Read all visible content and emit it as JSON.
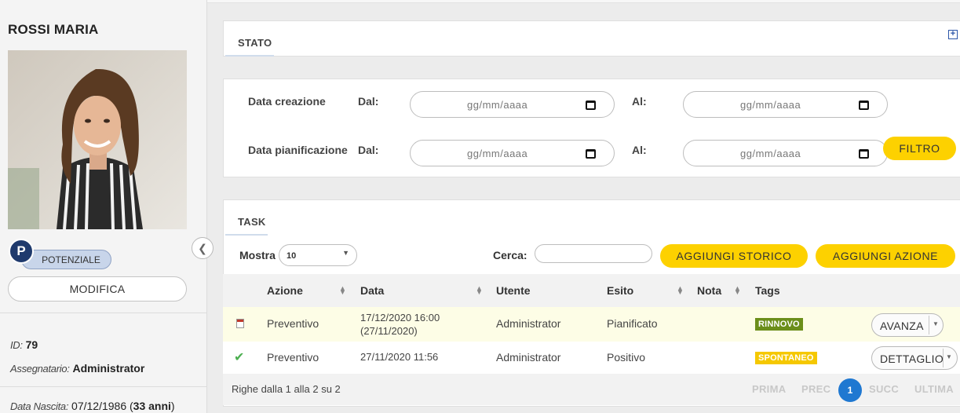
{
  "person": {
    "name": "ROSSI MARIA",
    "initial": "P",
    "status_badge": "POTENZIALE",
    "edit_label": "MODIFICA",
    "id_label": "ID:",
    "id_value": "79",
    "assignee_label": "Assegnatario:",
    "assignee_value": "Administrator",
    "birth_label": "Data Nascita:",
    "birth_value": "07/12/1986",
    "age_open": "(",
    "age_value": "33 anni",
    "age_close": ")"
  },
  "stato_panel": {
    "title": "STATO",
    "plus": "+"
  },
  "filters": {
    "creation_label": "Data creazione",
    "planning_label": "Data pianificazione",
    "from_label": "Dal:",
    "to_label": "Al:",
    "date_placeholder": "gg/mm/aaaa",
    "filter_button": "FILTRO"
  },
  "task_panel": {
    "title": "TASK",
    "show_label": "Mostra",
    "show_value": "10",
    "search_label": "Cerca:",
    "add_history_button": "AGGIUNGI STORICO",
    "add_action_button": "AGGIUNGI AZIONE",
    "columns": [
      "Azione",
      "Data",
      "Utente",
      "Esito",
      "Nota",
      "Tags"
    ],
    "rows": [
      {
        "icon": "calendar-icon",
        "azione": "Preventivo",
        "data_line1": "17/12/2020 16:00",
        "data_line2": "(27/11/2020)",
        "utente": "Administrator",
        "esito": "Pianificato",
        "nota": "",
        "tag": "RINNOVO",
        "tag_color": "#6b8e1a",
        "button": "AVANZA",
        "row_color": "#fdfde6"
      },
      {
        "icon": "check-icon",
        "azione": "Preventivo",
        "data_line1": "27/11/2020 11:56",
        "data_line2": "",
        "utente": "Administrator",
        "esito": "Positivo",
        "nota": "",
        "tag": "SPONTANEO",
        "tag_color": "#f5c800",
        "button": "DETTAGLIO",
        "row_color": "#ffffff"
      }
    ],
    "footer_text": "Righe dalla 1 alla 2 su 2",
    "pager": {
      "first": "PRIMA",
      "prev": "PREC",
      "page": "1",
      "next": "SUCC",
      "last": "ULTIMA"
    }
  }
}
